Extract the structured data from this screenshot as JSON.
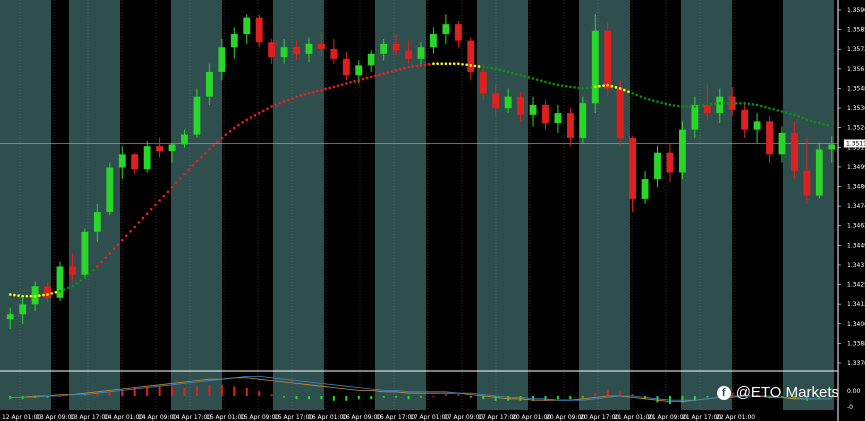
{
  "chart_data": {
    "type": "candlestick",
    "instrument_price_now": "1.35116",
    "price_axis_labels": [
      "1.35900",
      "1.35855",
      "1.35730",
      "1.35610",
      "1.35485",
      "1.35360",
      "1.35240",
      "1.35116",
      "1.34990",
      "1.34865",
      "1.34745",
      "1.34620",
      "1.34495",
      "1.34375",
      "1.34250",
      "1.34125",
      "1.34005",
      "1.33880",
      "1.33760"
    ],
    "time_axis_labels": [
      "12 Apr 01:00",
      "13 Apr 09:00",
      "13 Apr 17:00",
      "14 Apr 01:00",
      "14 Apr 09:00",
      "14 Apr 17:00",
      "15 Apr 01:00",
      "15 Apr 09:00",
      "15 Apr 17:00",
      "16 Apr 01:00",
      "16 Apr 09:00",
      "16 Apr 17:00",
      "17 Apr 01:00",
      "17 Apr 09:00",
      "17 Apr 17:00",
      "20 Apr 01:00",
      "20 Apr 09:00",
      "20 Apr 17:00",
      "21 Apr 01:00",
      "21 Apr 09:00",
      "21 Apr 17:00",
      "22 Apr 01:00"
    ],
    "ylim": [
      1.3376,
      1.3595
    ],
    "osc_axis_labels": [
      "0.00",
      "-0"
    ],
    "candles": [
      [
        1.3405,
        1.3412,
        1.3399,
        1.3408
      ],
      [
        1.3408,
        1.3418,
        1.3402,
        1.3414
      ],
      [
        1.3414,
        1.3428,
        1.341,
        1.3425
      ],
      [
        1.3425,
        1.3427,
        1.3415,
        1.3418
      ],
      [
        1.3418,
        1.344,
        1.3416,
        1.3437
      ],
      [
        1.3437,
        1.3445,
        1.3428,
        1.3432
      ],
      [
        1.3432,
        1.346,
        1.343,
        1.3458
      ],
      [
        1.3458,
        1.3475,
        1.3452,
        1.347
      ],
      [
        1.347,
        1.35,
        1.3468,
        1.3497
      ],
      [
        1.3497,
        1.351,
        1.349,
        1.3505
      ],
      [
        1.3505,
        1.3506,
        1.3493,
        1.3496
      ],
      [
        1.3496,
        1.3513,
        1.3494,
        1.351
      ],
      [
        1.351,
        1.3515,
        1.3503,
        1.3507
      ],
      [
        1.3507,
        1.3512,
        1.35,
        1.3511
      ],
      [
        1.3511,
        1.352,
        1.3509,
        1.3517
      ],
      [
        1.3517,
        1.3545,
        1.3515,
        1.354
      ],
      [
        1.354,
        1.356,
        1.3535,
        1.3555
      ],
      [
        1.3555,
        1.3575,
        1.355,
        1.357
      ],
      [
        1.357,
        1.3582,
        1.3563,
        1.3578
      ],
      [
        1.3578,
        1.359,
        1.3572,
        1.3588
      ],
      [
        1.3588,
        1.359,
        1.357,
        1.3573
      ],
      [
        1.3573,
        1.3575,
        1.356,
        1.3564
      ],
      [
        1.3564,
        1.3575,
        1.356,
        1.357
      ],
      [
        1.357,
        1.3574,
        1.3562,
        1.3566
      ],
      [
        1.3566,
        1.3576,
        1.3561,
        1.3572
      ],
      [
        1.3572,
        1.3578,
        1.3565,
        1.3569
      ],
      [
        1.3569,
        1.3575,
        1.356,
        1.3563
      ],
      [
        1.3563,
        1.3567,
        1.355,
        1.3553
      ],
      [
        1.3553,
        1.3562,
        1.3548,
        1.3559
      ],
      [
        1.3559,
        1.3568,
        1.3555,
        1.3566
      ],
      [
        1.3566,
        1.3575,
        1.3562,
        1.3572
      ],
      [
        1.3572,
        1.3578,
        1.3565,
        1.3568
      ],
      [
        1.3568,
        1.3574,
        1.356,
        1.3563
      ],
      [
        1.3563,
        1.3573,
        1.3558,
        1.357
      ],
      [
        1.357,
        1.3582,
        1.3566,
        1.3578
      ],
      [
        1.3578,
        1.359,
        1.3572,
        1.3584
      ],
      [
        1.3584,
        1.3586,
        1.357,
        1.3574
      ],
      [
        1.3574,
        1.3576,
        1.355,
        1.3555
      ],
      [
        1.3555,
        1.356,
        1.3538,
        1.3542
      ],
      [
        1.3542,
        1.3548,
        1.3528,
        1.3533
      ],
      [
        1.3533,
        1.3545,
        1.353,
        1.354
      ],
      [
        1.354,
        1.3543,
        1.3525,
        1.3529
      ],
      [
        1.3529,
        1.354,
        1.3522,
        1.3535
      ],
      [
        1.3535,
        1.3538,
        1.352,
        1.3524
      ],
      [
        1.3524,
        1.3535,
        1.3518,
        1.353
      ],
      [
        1.353,
        1.3533,
        1.351,
        1.3515
      ],
      [
        1.3515,
        1.354,
        1.3512,
        1.3536
      ],
      [
        1.3536,
        1.359,
        1.353,
        1.358
      ],
      [
        1.358,
        1.3585,
        1.354,
        1.3545
      ],
      [
        1.3545,
        1.355,
        1.351,
        1.3515
      ],
      [
        1.3515,
        1.3516,
        1.347,
        1.3478
      ],
      [
        1.3478,
        1.3495,
        1.3475,
        1.349
      ],
      [
        1.349,
        1.351,
        1.3485,
        1.3506
      ],
      [
        1.3506,
        1.3512,
        1.3488,
        1.3494
      ],
      [
        1.3494,
        1.3525,
        1.349,
        1.352
      ],
      [
        1.352,
        1.354,
        1.3515,
        1.3535
      ],
      [
        1.3535,
        1.3548,
        1.3526,
        1.353
      ],
      [
        1.353,
        1.3545,
        1.3524,
        1.354
      ],
      [
        1.354,
        1.3546,
        1.3528,
        1.3532
      ],
      [
        1.3532,
        1.3536,
        1.3515,
        1.352
      ],
      [
        1.352,
        1.353,
        1.3512,
        1.3525
      ],
      [
        1.3525,
        1.3528,
        1.35,
        1.3505
      ],
      [
        1.3505,
        1.3522,
        1.35,
        1.3518
      ],
      [
        1.3518,
        1.3525,
        1.349,
        1.3495
      ],
      [
        1.3495,
        1.3515,
        1.3475,
        1.348
      ],
      [
        1.348,
        1.3512,
        1.3478,
        1.3508
      ],
      [
        1.3508,
        1.3516,
        1.35,
        1.3511
      ]
    ],
    "indicator_line": [
      1.342,
      1.3419,
      1.3419,
      1.342,
      1.3422,
      1.3425,
      1.343,
      1.3437,
      1.3445,
      1.3453,
      1.3461,
      1.3469,
      1.3477,
      1.3485,
      1.3493,
      1.3501,
      1.3508,
      1.3515,
      1.3521,
      1.3526,
      1.353,
      1.3534,
      1.3537,
      1.354,
      1.3542,
      1.3544,
      1.3546,
      1.3548,
      1.355,
      1.3552,
      1.3554,
      1.3556,
      1.3558,
      1.3559,
      1.356,
      1.356,
      1.356,
      1.3559,
      1.3558,
      1.3557,
      1.3555,
      1.3553,
      1.3551,
      1.3549,
      1.3547,
      1.3546,
      1.3545,
      1.3546,
      1.3547,
      1.3545,
      1.3542,
      1.3539,
      1.3537,
      1.3535,
      1.3534,
      1.3534,
      1.3535,
      1.3536,
      1.3536,
      1.3536,
      1.3535,
      1.3533,
      1.3531,
      1.3529,
      1.3526,
      1.3524,
      1.3522
    ],
    "indicator_color_segments": [
      {
        "from": 0,
        "to": 4,
        "color": "#ffff00"
      },
      {
        "from": 4,
        "to": 7,
        "color": "#0a8f0a"
      },
      {
        "from": 7,
        "to": 34,
        "color": "#e62020"
      },
      {
        "from": 34,
        "to": 38,
        "color": "#ffff00"
      },
      {
        "from": 38,
        "to": 47,
        "color": "#0a8f0a"
      },
      {
        "from": 47,
        "to": 50,
        "color": "#ffff00"
      },
      {
        "from": 50,
        "to": 66,
        "color": "#0a8f0a"
      }
    ],
    "osc_histogram": [
      -2,
      -2,
      -1,
      -1,
      0,
      1,
      1,
      2,
      3,
      4,
      5,
      5,
      6,
      6,
      5,
      6,
      7,
      7,
      6,
      5,
      3,
      1,
      -1,
      -2,
      -2,
      -2,
      -3,
      -3,
      -2,
      -2,
      -1,
      -1,
      -2,
      -1,
      0,
      1,
      1,
      -1,
      -2,
      -3,
      -3,
      -3,
      -3,
      -3,
      -2,
      -2,
      -1,
      2,
      4,
      3,
      1,
      -2,
      -4,
      -5,
      -4,
      -3,
      -1,
      1,
      2,
      2,
      1,
      -1,
      -1,
      -2,
      -3,
      -2,
      -1
    ],
    "osc_line_a": [
      -1,
      -1,
      0,
      0,
      1,
      1,
      2,
      3,
      4,
      5,
      6,
      7,
      8,
      9,
      10,
      11,
      12,
      12,
      13,
      13,
      12,
      11,
      10,
      9,
      8,
      7,
      6,
      5,
      4,
      4,
      3,
      3,
      2,
      2,
      2,
      2,
      2,
      1,
      0,
      -1,
      -2,
      -2,
      -3,
      -3,
      -3,
      -3,
      -2,
      -1,
      0,
      0,
      -1,
      -2,
      -3,
      -4,
      -4,
      -3,
      -2,
      -1,
      0,
      0,
      0,
      -1,
      -1,
      -2,
      -2,
      -2,
      -2
    ],
    "osc_line_b": [
      -1,
      -1,
      -1,
      0,
      0,
      1,
      1,
      2,
      3,
      4,
      5,
      6,
      7,
      8,
      9,
      10,
      11,
      12,
      13,
      14,
      14,
      13,
      12,
      11,
      10,
      9,
      8,
      7,
      6,
      5,
      4,
      4,
      3,
      3,
      3,
      3,
      2,
      2,
      1,
      0,
      -1,
      -1,
      -2,
      -2,
      -3,
      -3,
      -3,
      -2,
      -1,
      0,
      0,
      -1,
      -2,
      -3,
      -3,
      -3,
      -2,
      -1,
      -1,
      0,
      0,
      0,
      -1,
      -1,
      -2,
      -2,
      -2
    ],
    "colors": {
      "bull": "#2bd62b",
      "bear": "#e02020",
      "band_dark": "#000000",
      "band_light": "#2f4f4f",
      "osc_line_a": "#d08a2c",
      "osc_line_b": "#3c86c8"
    }
  },
  "watermark": {
    "icon": "facebook-icon",
    "text": "@ETO Markets"
  }
}
